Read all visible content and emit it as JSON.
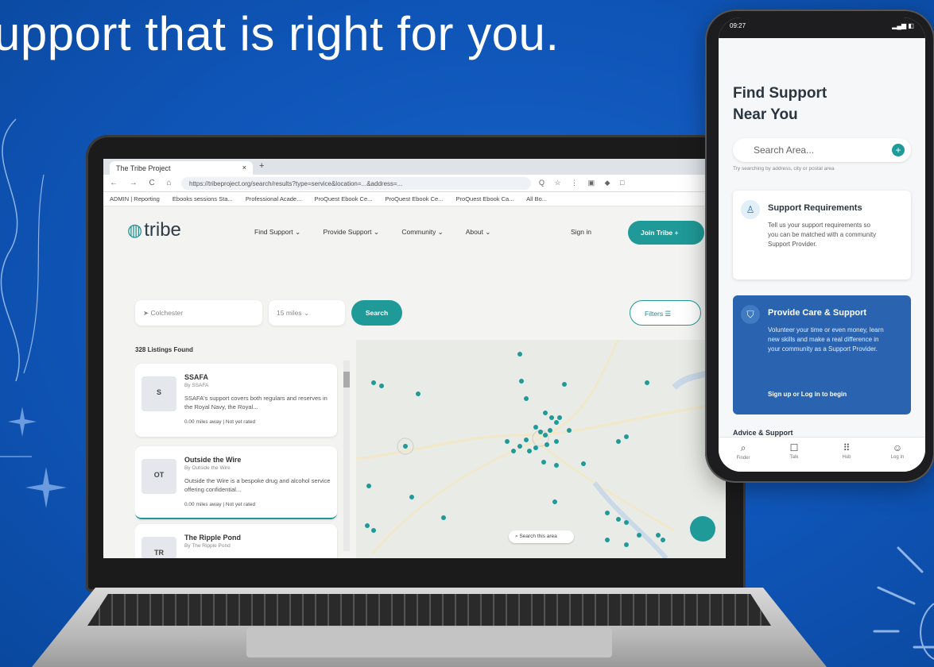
{
  "headline": "upport that is right for you.",
  "browser": {
    "tab_title": "The Tribe Project",
    "tab_close": "×",
    "new_tab": "+",
    "nav_buttons": "← → C ⌂",
    "url": "https://tribeproject.org/search/results?type=service&location=...&address=...",
    "ext_icons": "Q ☆ ⋮ ▣ ◆ □",
    "bookmarks": [
      "ADMIN | Reporting",
      "Ebooks sessions Sta...",
      "Professional Acade...",
      "ProQuest Ebook Ce...",
      "ProQuest Ebook Ce...",
      "ProQuest Ebook Ca...",
      "All Bo..."
    ]
  },
  "site": {
    "logo": "tribe",
    "nav": [
      "Find Support ⌄",
      "Provide Support ⌄",
      "Community ⌄",
      "About ⌄"
    ],
    "sign_in": "Sign in",
    "join": "Join Tribe  +",
    "location_placeholder": "Colchester",
    "miles": "15 miles  ⌄",
    "search": "Search",
    "filters": "Filters   ☰",
    "listings_found": "328 Listings Found",
    "map_search": "Search this area"
  },
  "listings": [
    {
      "avatar": "S",
      "title": "SSAFA",
      "by": "By SSAFA",
      "desc": "SSAFA's support covers both regulars and reserves in the Royal Navy, the Royal...",
      "meta": "0.00 miles away  |  Not yet rated"
    },
    {
      "avatar": "OT",
      "title": "Outside the Wire",
      "by": "By Outside the Wire",
      "desc": "Outside the Wire is a bespoke drug and alcohol service offering confidential...",
      "meta": "0.00 miles away  |  Not yet rated"
    },
    {
      "avatar": "TR",
      "title": "The Ripple Pond",
      "by": "By The Ripple Pond",
      "desc": "",
      "meta": ""
    }
  ],
  "phone": {
    "time": "09:27",
    "status": "▂▄▆ ◧",
    "title_line1": "Find Support",
    "title_line2": "Near You",
    "search_placeholder": "Search Area...",
    "search_plus": "+",
    "hint": "Try searching by address, city or postal area",
    "req": {
      "title": "Support Requirements",
      "desc": "Tell us your support requirements so you can be matched with a community Support Provider."
    },
    "care": {
      "title": "Provide Care & Support",
      "desc": "Volunteer your time or even money, learn new skills and make a real difference in your community as a Support Provider.",
      "cta": "Sign up or Log in to begin"
    },
    "advice": "Advice & Support",
    "bottom_nav": [
      {
        "icon": "⌕",
        "label": "Finder"
      },
      {
        "icon": "☐",
        "label": "Talk"
      },
      {
        "icon": "⠿",
        "label": "Hub"
      },
      {
        "icon": "☺",
        "label": "Log In"
      }
    ]
  },
  "colors": {
    "background": "#0f55b8",
    "teal": "#1f9a98",
    "care_card": "#2a64b0"
  }
}
